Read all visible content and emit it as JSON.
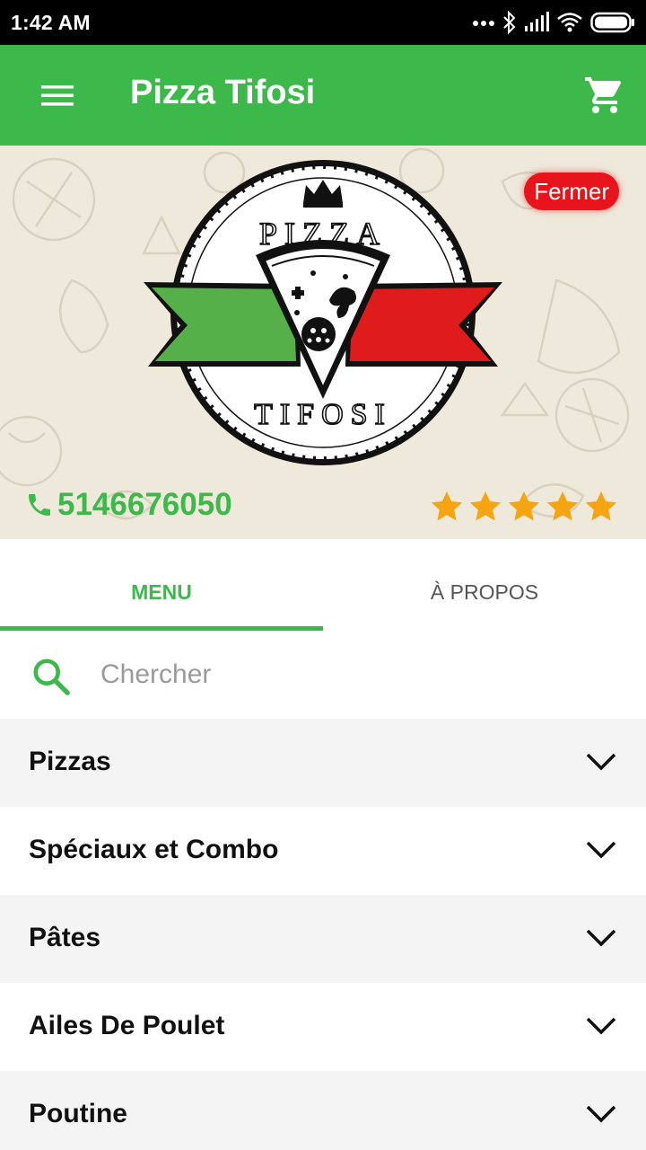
{
  "status_bar": {
    "time": "1:42 AM",
    "icons": [
      "more-dots-icon",
      "bluetooth-icon",
      "signal-icon",
      "wifi-icon",
      "battery-icon"
    ]
  },
  "app_bar": {
    "title": "Pizza Tifosi",
    "menu_icon": "hamburger-menu-icon",
    "cart_icon": "cart-icon"
  },
  "hero": {
    "logo": {
      "top_text": "PIZZA",
      "bottom_text": "TIFOSI"
    },
    "status_badge": "Fermer",
    "phone": "5146676050",
    "rating": 5,
    "rating_max": 5
  },
  "tabs": [
    {
      "label": "MENU",
      "active": true
    },
    {
      "label": "À PROPOS",
      "active": false
    }
  ],
  "search": {
    "placeholder": "Chercher",
    "value": ""
  },
  "categories": [
    {
      "label": "Pizzas"
    },
    {
      "label": "Spéciaux et Combo"
    },
    {
      "label": "Pâtes"
    },
    {
      "label": "Ailes De Poulet"
    },
    {
      "label": "Poutine"
    }
  ],
  "colors": {
    "primary": "#3db84b",
    "badge": "#e8141c",
    "star": "#f5a511",
    "hero_bg": "#efe9dc",
    "row_alt": "#f4f4f4"
  }
}
